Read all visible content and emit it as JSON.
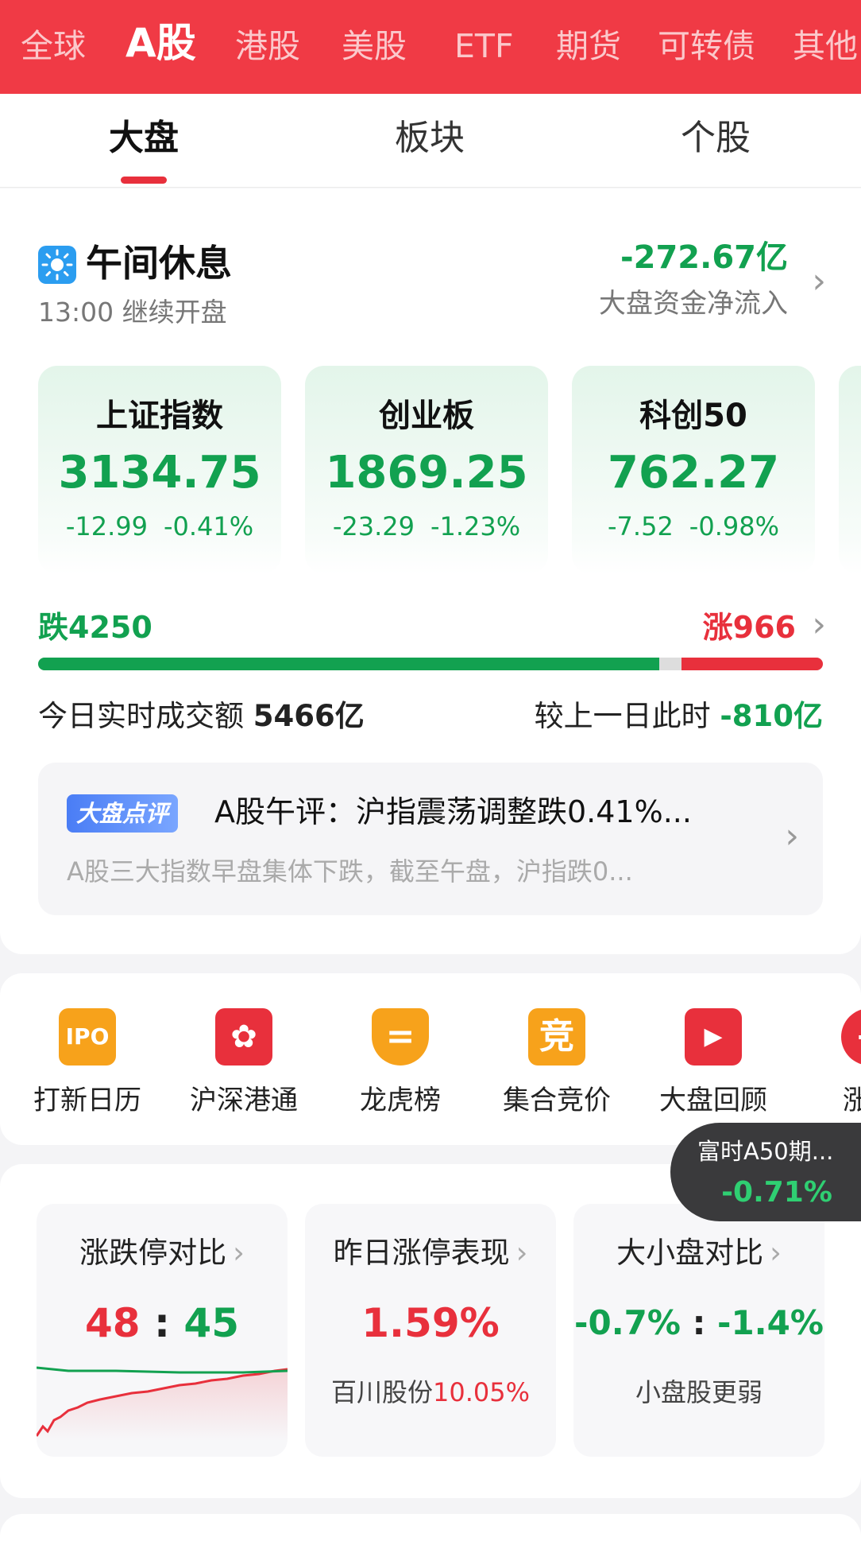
{
  "market_tabs": [
    "全球",
    "A股",
    "港股",
    "美股",
    "ETF",
    "期货",
    "可转债",
    "其他"
  ],
  "sub_tabs": [
    "大盘",
    "板块",
    "个股"
  ],
  "session": {
    "title": "午间休息",
    "subtitle": "13:00 继续开盘",
    "net_flow_value": "-272.67亿",
    "net_flow_label": "大盘资金净流入"
  },
  "indices": [
    {
      "name": "上证指数",
      "value": "3134.75",
      "change": "-12.99",
      "pct": "-0.41%"
    },
    {
      "name": "创业板",
      "value": "1869.25",
      "change": "-23.29",
      "pct": "-1.23%"
    },
    {
      "name": "科创50",
      "value": "762.27",
      "change": "-7.52",
      "pct": "-0.98%"
    }
  ],
  "breadth": {
    "down_label": "跌4250",
    "up_label": "涨966",
    "down": 4250,
    "up": 966
  },
  "turnover": {
    "label": "今日实时成交额",
    "value": "5466亿",
    "compare_label": "较上一日此时",
    "compare_value": "-810亿"
  },
  "commentary": {
    "badge": "大盘点评",
    "title": "A股午评：沪指震荡调整跌0.41%...",
    "summary": "A股三大指数早盘集体下跌，截至午盘，沪指跌0..."
  },
  "tools": [
    {
      "label": "打新日历",
      "icon": "ipo-calendar-icon",
      "glyph": "IPO",
      "color": "#f7a21b"
    },
    {
      "label": "沪深港通",
      "icon": "hk-connect-icon",
      "glyph": "✿",
      "color": "#e8303c"
    },
    {
      "label": "龙虎榜",
      "icon": "dragon-tiger-icon",
      "glyph": "=",
      "color": "#f7a21b"
    },
    {
      "label": "集合竞价",
      "icon": "auction-icon",
      "glyph": "竞",
      "color": "#f7a21b"
    },
    {
      "label": "大盘回顾",
      "icon": "market-review-icon",
      "glyph": "▶",
      "color": "#e8303c"
    },
    {
      "label": "涨停",
      "icon": "limit-up-icon",
      "glyph": "+",
      "color": "#e8303c"
    }
  ],
  "floating": {
    "name": "富时A50期...",
    "value": "-0.71%"
  },
  "stats": [
    {
      "title": "涨跌停对比",
      "value_up": "48",
      "sep": ":",
      "value_down": "45"
    },
    {
      "title": "昨日涨停表现",
      "value": "1.59%",
      "foot_name": "百川股份",
      "foot_value": "10.05%"
    },
    {
      "title": "大小盘对比",
      "value_a": "-0.7%",
      "sep": ":",
      "value_b": "-1.4%",
      "foot": "小盘股更弱"
    }
  ],
  "colors": {
    "brand_red": "#f03a45",
    "down_green": "#12a150",
    "up_red": "#e8303c"
  }
}
